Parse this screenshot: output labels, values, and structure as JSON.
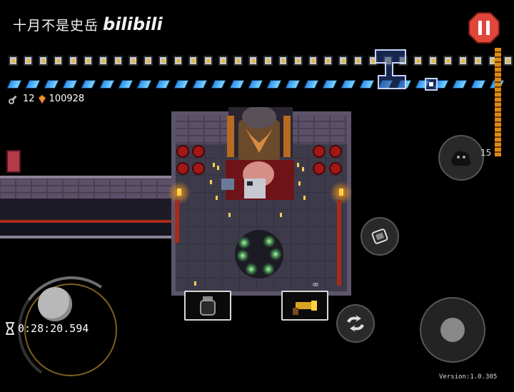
{
  "watermark": {
    "channel": "十月不是史岳",
    "brand": "bilibili"
  },
  "hud": {
    "hearts_count": 34,
    "gems_count": 27,
    "keys": "12",
    "currency": "100928",
    "blank_count": "15",
    "ammo": "∞"
  },
  "timer": {
    "value": "0:28:20.594",
    "icon": "hourglass-icon"
  },
  "version": "Version:1.0.305",
  "colors": {
    "pause": "#e0463a",
    "wall": "#7a7088",
    "floor": "#3a3848",
    "carpet": "#8a1a22",
    "torch": "#ff9a1a",
    "portal": "#5cff7a"
  },
  "icons": {
    "pause": "pause-icon",
    "heart": "heart-container-icon",
    "armor": "armor-gem-icon",
    "key": "key-icon",
    "currency": "hegemony-credit-icon",
    "book": "spellbook-icon",
    "blank": "blank-ghost-icon",
    "reload": "reload-icon",
    "swap": "swap-weapon-icon",
    "active_item": "potion-jar-icon",
    "gun": "blunderbuss-icon"
  }
}
